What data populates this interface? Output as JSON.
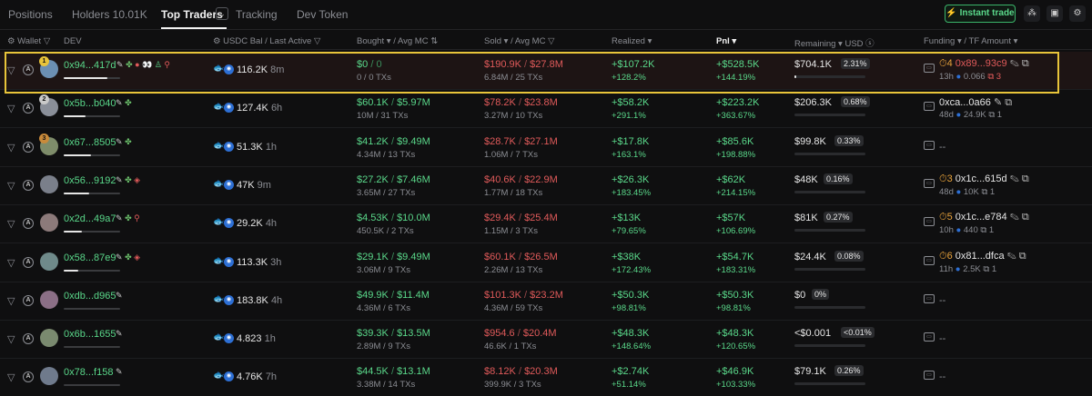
{
  "tabs": [
    {
      "label": "Positions",
      "active": false
    },
    {
      "label": "Holders 10.01K",
      "active": false
    },
    {
      "label": "Top Traders",
      "active": true
    },
    {
      "label": "Tracking",
      "active": false
    },
    {
      "label": "Dev Token",
      "active": false
    }
  ],
  "toolbar": {
    "instant_trade": "Instant trade"
  },
  "columns": {
    "wallet": "Wallet",
    "dev": "DEV",
    "usdc_bal": "USDC Bal",
    "last_active": "/ Last Active",
    "bought": "Bought",
    "avg_mc_b": "/ Avg MC",
    "sold": "Sold",
    "avg_mc_s": "/ Avg MC",
    "realized": "Realized",
    "pnl": "Pnl",
    "remaining": "Remaining",
    "usd": "USD",
    "funding": "Funding",
    "tf_amount": "/ TF Amount"
  },
  "colors": {
    "green": "#5ad88a",
    "red": "#e05a5a",
    "highlight": "#e8c43a"
  },
  "rows": [
    {
      "rank": "1",
      "wallet": "0x94...417d",
      "balance": "116.2K",
      "last_active": "8m",
      "bought": "$0",
      "bought_mc": "0",
      "bought_sub": "0 / 0 TXs",
      "sold": "$190.9K",
      "sold_mc": "$27.8M",
      "sold_sub": "6.84M / 25 TXs",
      "realized": "+$107.2K",
      "realized_pct": "+128.2%",
      "pnl": "+$528.5K",
      "pnl_pct": "+144.19%",
      "remaining": "$704.1K",
      "remaining_pct": "2.31%",
      "remaining_frac": 0.03,
      "funding_count": "4",
      "funding_addr": "0x89...93c9",
      "funding_time": "13h",
      "funding_amount": "0.066",
      "funding_txs": "3"
    },
    {
      "rank": "2",
      "wallet": "0x5b...b040",
      "balance": "127.4K",
      "last_active": "6h",
      "bought": "$60.1K",
      "bought_mc": "$5.97M",
      "bought_sub": "10M / 31 TXs",
      "sold": "$78.2K",
      "sold_mc": "$23.8M",
      "sold_sub": "3.27M / 10 TXs",
      "realized": "+$58.2K",
      "realized_pct": "+291.1%",
      "pnl": "+$223.2K",
      "pnl_pct": "+363.67%",
      "remaining": "$206.3K",
      "remaining_pct": "0.68%",
      "remaining_frac": 0.0,
      "funding_count": "",
      "funding_addr": "0xca...0a66",
      "funding_time": "48d",
      "funding_amount": "24.9K",
      "funding_txs": "1"
    },
    {
      "rank": "3",
      "wallet": "0x67...8505",
      "balance": "51.3K",
      "last_active": "1h",
      "bought": "$41.2K",
      "bought_mc": "$9.49M",
      "bought_sub": "4.34M / 13 TXs",
      "sold": "$28.7K",
      "sold_mc": "$27.1M",
      "sold_sub": "1.06M / 7 TXs",
      "realized": "+$17.8K",
      "realized_pct": "+163.1%",
      "pnl": "+$85.6K",
      "pnl_pct": "+198.88%",
      "remaining": "$99.8K",
      "remaining_pct": "0.33%",
      "remaining_frac": 0.0,
      "funding_count": "",
      "funding_addr": "--",
      "funding_time": "",
      "funding_amount": "",
      "funding_txs": ""
    },
    {
      "rank": "",
      "wallet": "0x56...9192",
      "balance": "47K",
      "last_active": "9m",
      "bought": "$27.2K",
      "bought_mc": "$7.46M",
      "bought_sub": "3.65M / 27 TXs",
      "sold": "$40.6K",
      "sold_mc": "$22.9M",
      "sold_sub": "1.77M / 18 TXs",
      "realized": "+$26.3K",
      "realized_pct": "+183.45%",
      "pnl": "+$62K",
      "pnl_pct": "+214.15%",
      "remaining": "$48K",
      "remaining_pct": "0.16%",
      "remaining_frac": 0.0,
      "funding_count": "3",
      "funding_addr": "0x1c...615d",
      "funding_time": "48d",
      "funding_amount": "10K",
      "funding_txs": "1"
    },
    {
      "rank": "",
      "wallet": "0x2d...49a7",
      "balance": "29.2K",
      "last_active": "4h",
      "bought": "$4.53K",
      "bought_mc": "$10.0M",
      "bought_sub": "450.5K / 2 TXs",
      "sold": "$29.4K",
      "sold_mc": "$25.4M",
      "sold_sub": "1.15M / 3 TXs",
      "realized": "+$13K",
      "realized_pct": "+79.65%",
      "pnl": "+$57K",
      "pnl_pct": "+106.69%",
      "remaining": "$81K",
      "remaining_pct": "0.27%",
      "remaining_frac": 0.0,
      "funding_count": "5",
      "funding_addr": "0x1c...e784",
      "funding_time": "10h",
      "funding_amount": "440",
      "funding_txs": "1"
    },
    {
      "rank": "",
      "wallet": "0x58...87e9",
      "balance": "113.3K",
      "last_active": "3h",
      "bought": "$29.1K",
      "bought_mc": "$9.49M",
      "bought_sub": "3.06M / 9 TXs",
      "sold": "$60.1K",
      "sold_mc": "$26.5M",
      "sold_sub": "2.26M / 13 TXs",
      "realized": "+$38K",
      "realized_pct": "+172.43%",
      "pnl": "+$54.7K",
      "pnl_pct": "+183.31%",
      "remaining": "$24.4K",
      "remaining_pct": "0.08%",
      "remaining_frac": 0.0,
      "funding_count": "6",
      "funding_addr": "0x81...dfca",
      "funding_time": "11h",
      "funding_amount": "2.5K",
      "funding_txs": "1"
    },
    {
      "rank": "",
      "wallet": "0xdb...d965",
      "balance": "183.8K",
      "last_active": "4h",
      "bought": "$49.9K",
      "bought_mc": "$11.4M",
      "bought_sub": "4.36M / 6 TXs",
      "sold": "$101.3K",
      "sold_mc": "$23.2M",
      "sold_sub": "4.36M / 59 TXs",
      "realized": "+$50.3K",
      "realized_pct": "+98.81%",
      "pnl": "+$50.3K",
      "pnl_pct": "+98.81%",
      "remaining": "$0",
      "remaining_pct": "0%",
      "remaining_frac": 0.0,
      "funding_count": "",
      "funding_addr": "--",
      "funding_time": "",
      "funding_amount": "",
      "funding_txs": ""
    },
    {
      "rank": "",
      "wallet": "0x6b...1655",
      "balance": "4.823",
      "last_active": "1h",
      "bought": "$39.3K",
      "bought_mc": "$13.5M",
      "bought_sub": "2.89M / 9 TXs",
      "sold": "$954.6",
      "sold_mc": "$20.4M",
      "sold_sub": "46.6K / 1 TXs",
      "realized": "+$48.3K",
      "realized_pct": "+148.64%",
      "pnl": "+$48.3K",
      "pnl_pct": "+120.65%",
      "remaining": "<$0.001",
      "remaining_pct": "<0.01%",
      "remaining_frac": 0.0,
      "funding_count": "",
      "funding_addr": "--",
      "funding_time": "",
      "funding_amount": "",
      "funding_txs": ""
    },
    {
      "rank": "",
      "wallet": "0x78...f158",
      "balance": "4.76K",
      "last_active": "7h",
      "bought": "$44.5K",
      "bought_mc": "$13.1M",
      "bought_sub": "3.38M / 14 TXs",
      "sold": "$8.12K",
      "sold_mc": "$20.3M",
      "sold_sub": "399.9K / 3 TXs",
      "realized": "+$2.74K",
      "realized_pct": "+51.14%",
      "pnl": "+$46.9K",
      "pnl_pct": "+103.33%",
      "remaining": "$79.1K",
      "remaining_pct": "0.26%",
      "remaining_frac": 0.0,
      "funding_count": "",
      "funding_addr": "--",
      "funding_time": "",
      "funding_amount": "",
      "funding_txs": ""
    }
  ]
}
